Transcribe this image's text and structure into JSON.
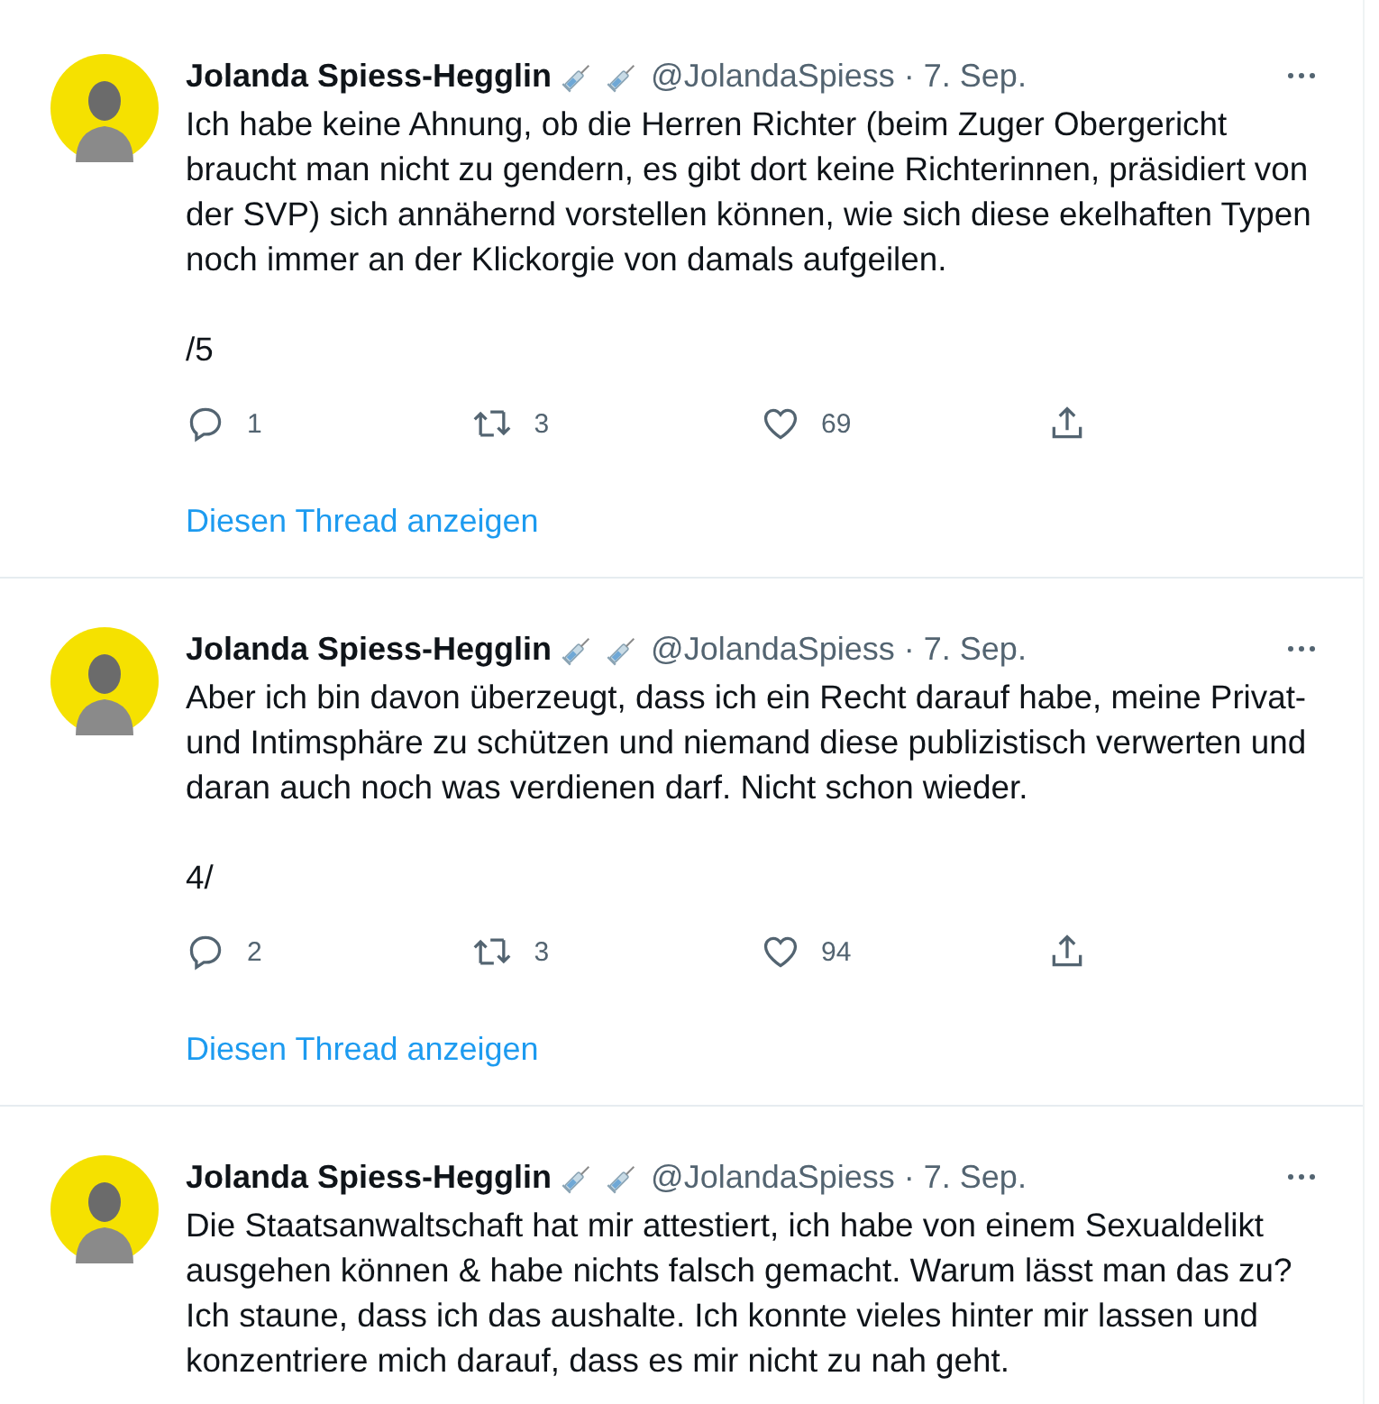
{
  "tweets": [
    {
      "name": "Jolanda Spiess-Hegglin",
      "handle": "@JolandaSpiess",
      "date": "· 7. Sep.",
      "paragraphs": [
        "Ich habe keine Ahnung, ob die Herren Richter (beim Zuger Obergericht braucht man nicht zu gendern, es gibt dort keine Richterinnen, präsidiert von der SVP) sich annähernd vorstellen können, wie sich diese ekelhaften Typen noch immer an der Klickorgie von damals aufgeilen.",
        "/5"
      ],
      "replies": "1",
      "retweets": "3",
      "likes": "69",
      "thread_link": "Diesen Thread anzeigen"
    },
    {
      "name": "Jolanda Spiess-Hegglin",
      "handle": "@JolandaSpiess",
      "date": "· 7. Sep.",
      "paragraphs": [
        "Aber ich bin davon überzeugt, dass ich ein Recht darauf habe, meine Privat- und Intimsphäre zu schützen und niemand diese publizistisch verwerten und daran auch noch was verdienen darf. Nicht schon wieder.",
        "4/"
      ],
      "replies": "2",
      "retweets": "3",
      "likes": "94",
      "thread_link": "Diesen Thread anzeigen"
    },
    {
      "name": "Jolanda Spiess-Hegglin",
      "handle": "@JolandaSpiess",
      "date": "· 7. Sep.",
      "paragraphs": [
        "Die Staatsanwaltschaft hat mir attestiert, ich habe von einem Sexualdelikt ausgehen können & habe nichts falsch gemacht. Warum lässt man das zu? Ich staune, dass ich das aushalte. Ich konnte vieles hinter mir lassen und konzentriere mich darauf, dass es mir nicht zu nah geht."
      ]
    }
  ]
}
